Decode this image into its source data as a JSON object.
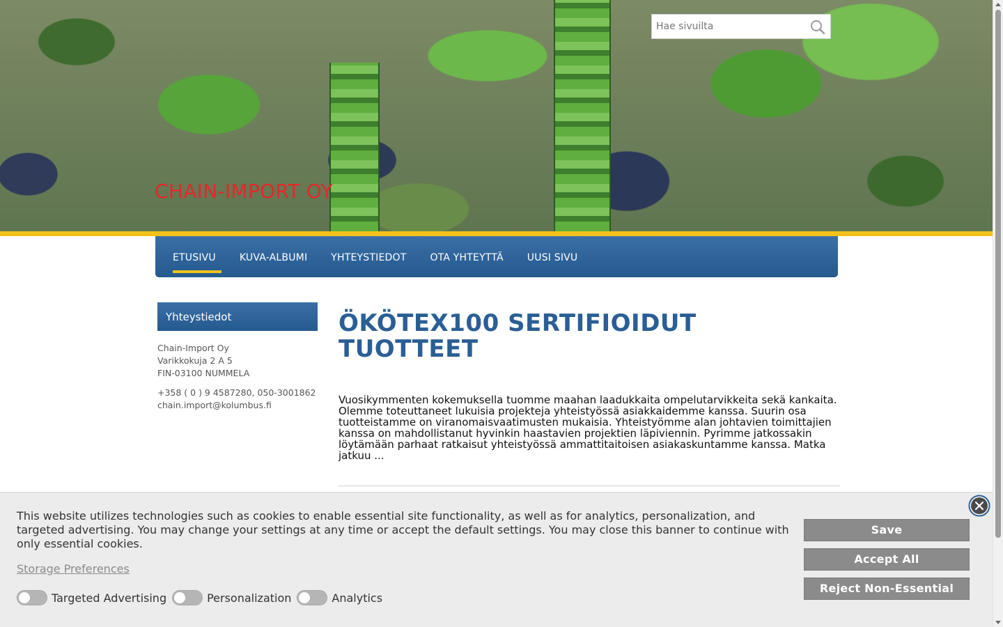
{
  "header": {
    "site_title": "CHAIN-IMPORT OY",
    "search_placeholder": "Hae sivuilta"
  },
  "nav": {
    "items": [
      {
        "label": "ETUSIVU",
        "active": true
      },
      {
        "label": "KUVA-ALBUMI"
      },
      {
        "label": "YHTEYSTIEDOT"
      },
      {
        "label": "OTA YHTEYTTÄ"
      },
      {
        "label": "UUSI SIVU"
      }
    ]
  },
  "sidebar": {
    "heading": "Yhteystiedot",
    "company": "Chain-Import Oy",
    "street": "Varikkokuja 2 A 5",
    "city": "FIN-03100 NUMMELA",
    "phone": "+358 ( 0 ) 9 4587280, 050-3001862",
    "email": "chain.import@kolumbus.fi"
  },
  "main": {
    "title": "ÖKÖTEX100 SERTIFIOIDUT TUOTTEET",
    "body": "Vuosikymmenten kokemuksella tuomme maahan laadukkaita ompelutarvikkeita sekä kankaita. Olemme toteuttaneet lukuisia projekteja yhteistyössä asiakkaidemme kanssa. Suurin osa tuotteistamme on viranomaisvaatimusten mukaisia. Yhteistyömme alan johtavien toimittajien kanssa on mahdollistanut hyvinkin haastavien projektien läpiviennin. Pyrimme jatkossakin löytämään parhaat ratkaisut yhteistyössä ammattitaitoisen asiakaskuntamme kanssa. Matka jatkuu ..."
  },
  "cookie_banner": {
    "text": "This website utilizes technologies such as cookies to enable essential site functionality, as well as for analytics, personalization, and targeted advertising. You may change your settings at any time or accept the default settings. You may close this banner to continue with only essential cookies.",
    "storage_preferences": "Storage Preferences",
    "toggles": [
      {
        "label": "Targeted Advertising"
      },
      {
        "label": "Personalization"
      },
      {
        "label": "Analytics"
      }
    ],
    "save_label": "Save",
    "accept_label": "Accept All",
    "reject_label": "Reject Non-Essential"
  },
  "icons": {
    "search": "search-icon",
    "close": "close-circle-icon"
  },
  "colors": {
    "brand_blue": "#2a5f95",
    "accent_yellow": "#f2c21b",
    "title_red": "#e8262a"
  }
}
